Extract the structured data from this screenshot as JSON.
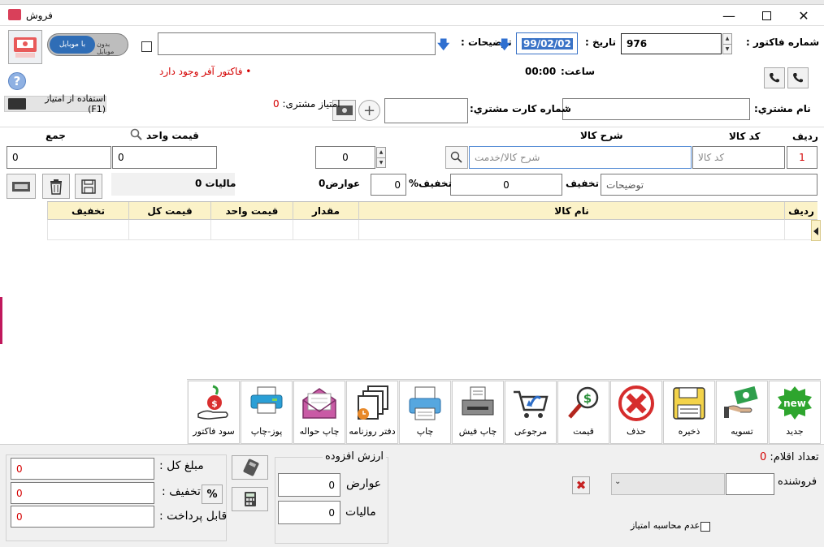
{
  "window": {
    "title": "فروش"
  },
  "header": {
    "invoice_number_label": "شماره فاکتور :",
    "invoice_number_value": "976",
    "date_label": "تاریخ :",
    "date_value": "99/02/02",
    "description_label": "توضیحات :",
    "description_value": "",
    "time_label": "ساعت:",
    "time_value": "00:00",
    "offer_notice": "• فاکتور آفر وجود دارد",
    "toggle_on_label": "بدون موبایل",
    "toggle_off_label": "با موبایل"
  },
  "customer": {
    "name_label": "نام مشتري:",
    "card_label": "شماره کارت مشتري:",
    "score_label": "امتیاز مشتری:",
    "score_value": "0",
    "use_score_label": "استفاده از امتیاز (F1)"
  },
  "entry": {
    "row_label": "ردیف",
    "row_value": "1",
    "code_label": "کد کالا",
    "code_placeholder": "کد کالا",
    "desc_label": "شرح کالا",
    "desc_placeholder": "شرح کالا/خدمت",
    "qty_value": "0",
    "unit_price_label": "قیمت واحد",
    "unit_price_value": "0",
    "total_label": "جمع",
    "total_value": "0",
    "notes_placeholder": "توضیحات",
    "discount_label": "تخفیف",
    "discount_value": "0",
    "discount_pct_label": "تخفیف%",
    "discount_pct_value": "0",
    "duties_label": "عوارض",
    "duties_value": "0",
    "tax_label": "مالیات",
    "tax_value": "0"
  },
  "grid": {
    "columns": [
      "ردیف",
      "نام کالا",
      "مقدار",
      "قیمت واحد",
      "قیمت کل",
      "تخفیف"
    ]
  },
  "toolbar": [
    {
      "label": "جدید",
      "icon": "new-icon"
    },
    {
      "label": "تسویه",
      "icon": "settle-icon"
    },
    {
      "label": "ذخیره",
      "icon": "save-icon"
    },
    {
      "label": "حذف",
      "icon": "delete-icon"
    },
    {
      "label": "قیمت",
      "icon": "price-icon"
    },
    {
      "label": "مرجوعی",
      "icon": "return-icon"
    },
    {
      "label": "چاپ فیش",
      "icon": "receipt-printer-icon"
    },
    {
      "label": "چاپ",
      "icon": "print-icon"
    },
    {
      "label": "دفتر روزنامه",
      "icon": "journal-icon"
    },
    {
      "label": "چاپ حواله",
      "icon": "remittance-icon"
    },
    {
      "label": "پوز-چاپ",
      "icon": "pos-print-icon"
    },
    {
      "label": "سود فاکتور",
      "icon": "profit-icon"
    }
  ],
  "footer": {
    "items_count_label": "تعداد اقلام:",
    "items_count_value": "0",
    "seller_label": "فروشنده",
    "no_score_label": "عدم محاسبه امتیاز",
    "vat_group_label": "ارزش افزوده",
    "duties_label": "عوارض",
    "duties_value": "0",
    "tax_label": "مالیات",
    "tax_value": "0",
    "total_label": "مبلغ کل :",
    "total_value": "0",
    "discount_label": "تخفیف :",
    "discount_value": "0",
    "payable_label": "قابل پرداخت :",
    "payable_value": "0",
    "percent_symbol": "%"
  }
}
